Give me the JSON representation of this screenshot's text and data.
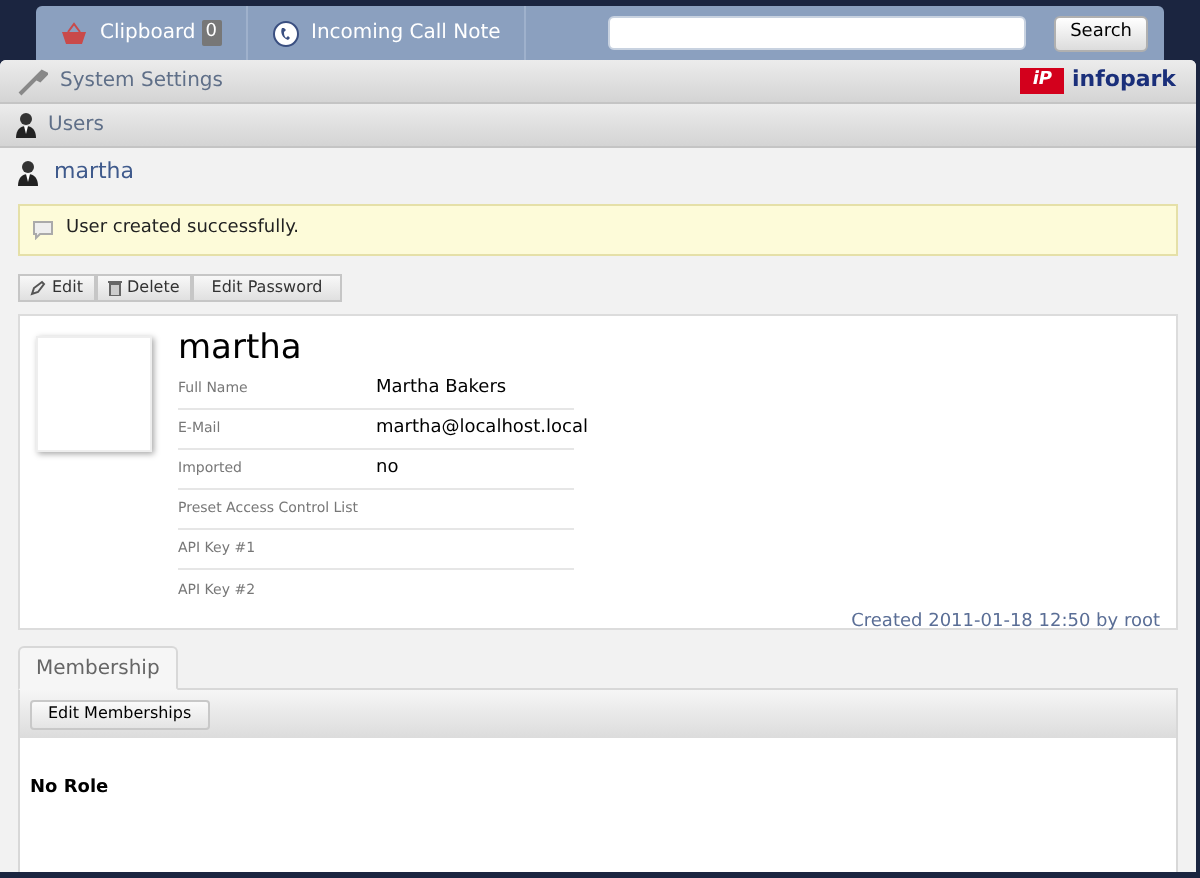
{
  "nav": {
    "items": [
      {
        "kind": "clipboard",
        "label": "Clipboard",
        "count": "0"
      },
      {
        "kind": "phone",
        "label": "Incoming Call Note"
      }
    ],
    "search": {
      "button": "Search"
    }
  },
  "breadcrumbs": [
    {
      "kind": "settings",
      "label": "System Settings"
    },
    {
      "kind": "user",
      "label": "Users"
    },
    {
      "kind": "user",
      "label": "martha"
    }
  ],
  "logo": {
    "mark": "iP",
    "text": "infopark"
  },
  "notice": "User created successfully.",
  "actions": [
    {
      "kind": "edit",
      "label": "Edit"
    },
    {
      "kind": "delete",
      "label": "Delete"
    },
    {
      "kind": "plain",
      "label": "Edit Password"
    }
  ],
  "user": {
    "name": "martha",
    "fields": [
      {
        "label": "Full Name",
        "value": "Martha Bakers"
      },
      {
        "label": "E-Mail",
        "value": "martha@localhost.local"
      },
      {
        "label": "Imported",
        "value": "no"
      },
      {
        "label": "Preset Access Control List"
      },
      {
        "label": "API Key #1"
      },
      {
        "label": "API Key #2"
      }
    ],
    "created": "Created 2011-01-18 12:50 by root"
  },
  "tabs": [
    {
      "label": "Membership",
      "selected": true
    }
  ],
  "membership": {
    "button": "Edit Memberships",
    "role": "No Role"
  }
}
